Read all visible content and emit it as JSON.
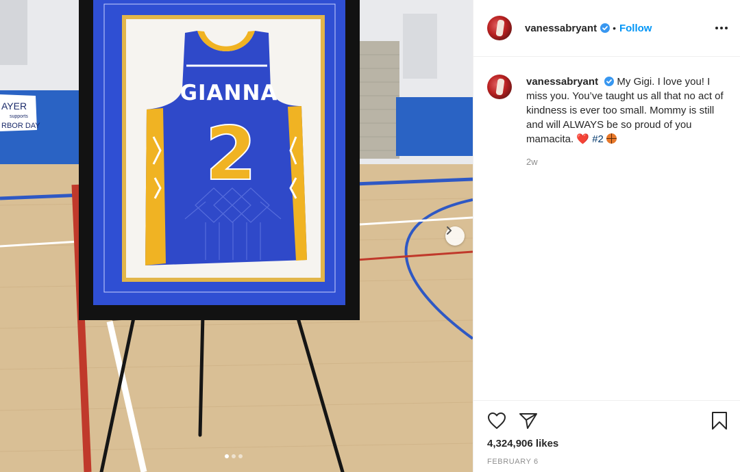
{
  "photo": {
    "jersey_name": "GIANNA",
    "jersey_number": "2",
    "banner_text_top": "AYER",
    "banner_text_mid": "supports",
    "banner_text_bottom": "RBOR DAY",
    "carousel_dot_count": 3,
    "carousel_active_index": 0
  },
  "post": {
    "username": "vanessabryant",
    "separator": "•",
    "follow_label": "Follow",
    "caption": {
      "username": "vanessabryant",
      "text": "My Gigi. I love you! I miss you. You’ve taught us all that no act of kindness is ever too small. Mommy is still and will ALWAYS be so proud of you mamacita.",
      "emoji_heart": "❤️",
      "hashtag": "#2"
    },
    "timestamp": "2w",
    "likes": "4,324,906 likes",
    "date": "FEBRUARY 6"
  },
  "icons": {
    "verified": "verified-badge-icon",
    "more": "more-options-icon",
    "like": "heart-outline-icon",
    "share": "paper-plane-icon",
    "save": "bookmark-icon",
    "next": "chevron-right-icon"
  },
  "colors": {
    "accent": "#0095f6",
    "hashtag": "#00376b",
    "muted": "#8e8e8e",
    "jersey_blue": "#2f49c9",
    "jersey_gold": "#f0b323"
  }
}
